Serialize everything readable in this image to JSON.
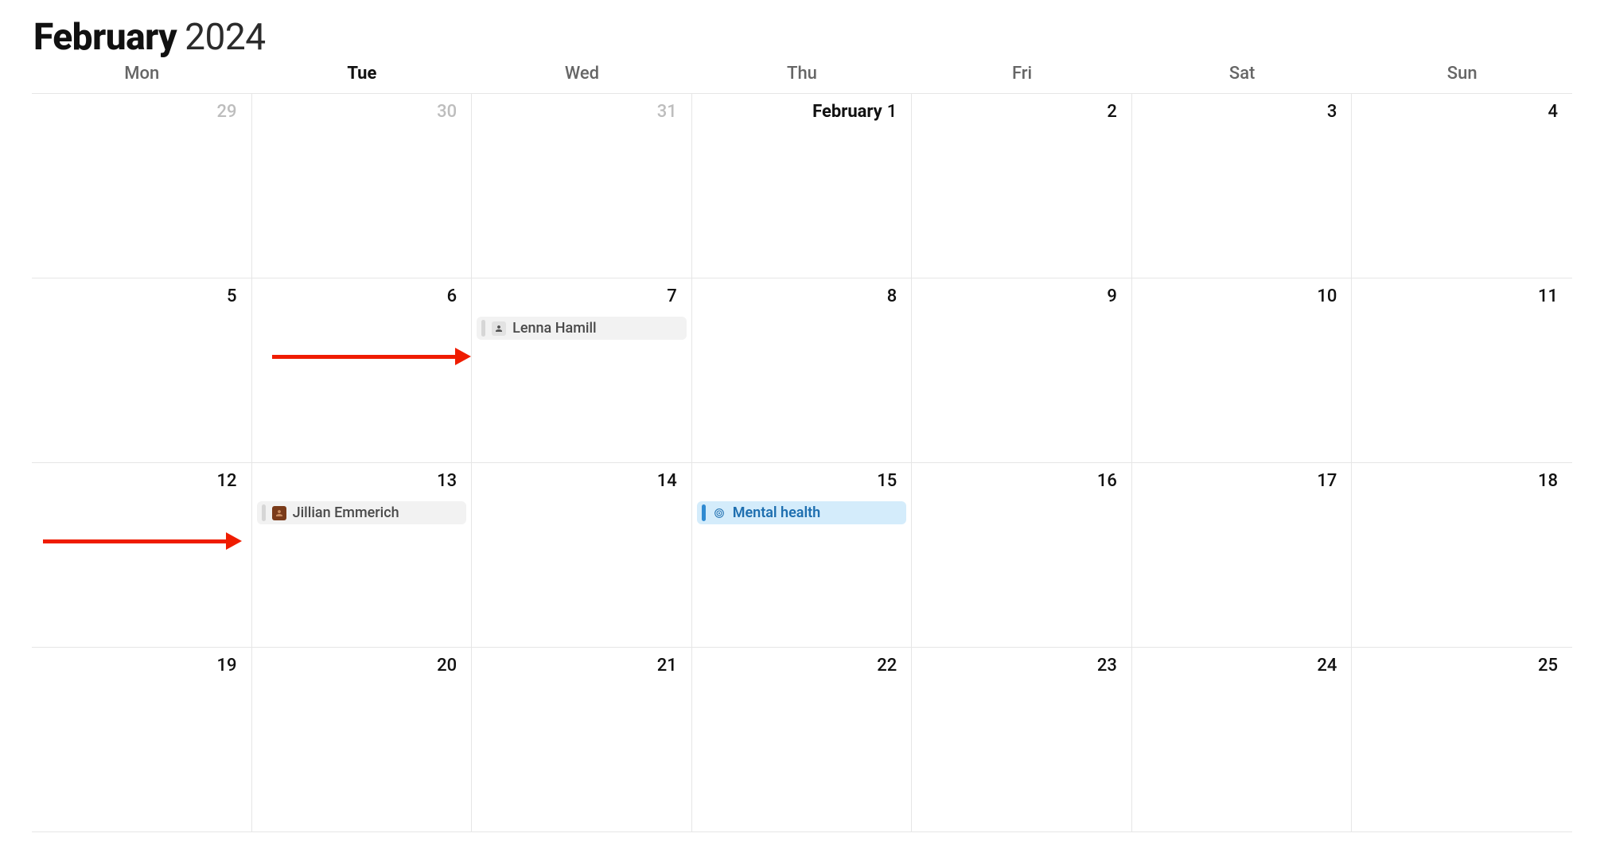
{
  "header": {
    "month": "February",
    "year": "2024"
  },
  "weekdays": [
    {
      "label": "Mon",
      "current": false
    },
    {
      "label": "Tue",
      "current": true
    },
    {
      "label": "Wed",
      "current": false
    },
    {
      "label": "Thu",
      "current": false
    },
    {
      "label": "Fri",
      "current": false
    },
    {
      "label": "Sat",
      "current": false
    },
    {
      "label": "Sun",
      "current": false
    }
  ],
  "rows": [
    [
      {
        "num": "29",
        "dim": true
      },
      {
        "num": "30",
        "dim": true
      },
      {
        "num": "31",
        "dim": true
      },
      {
        "num": "1",
        "monthPrefix": "February"
      },
      {
        "num": "2"
      },
      {
        "num": "3"
      },
      {
        "num": "4"
      }
    ],
    [
      {
        "num": "5"
      },
      {
        "num": "6"
      },
      {
        "num": "7",
        "events": [
          {
            "kind": "person",
            "icon": "person",
            "label": "Lenna Hamill"
          }
        ]
      },
      {
        "num": "8"
      },
      {
        "num": "9"
      },
      {
        "num": "10"
      },
      {
        "num": "11"
      }
    ],
    [
      {
        "num": "12"
      },
      {
        "num": "13",
        "events": [
          {
            "kind": "person",
            "icon": "person-brn",
            "label": "Jillian Emmerich"
          }
        ]
      },
      {
        "num": "14"
      },
      {
        "num": "15",
        "events": [
          {
            "kind": "blue",
            "icon": "target",
            "label": "Mental health"
          }
        ]
      },
      {
        "num": "16"
      },
      {
        "num": "17"
      },
      {
        "num": "18"
      }
    ],
    [
      {
        "num": "19"
      },
      {
        "num": "20"
      },
      {
        "num": "21"
      },
      {
        "num": "22"
      },
      {
        "num": "23"
      },
      {
        "num": "24"
      },
      {
        "num": "25"
      }
    ]
  ]
}
